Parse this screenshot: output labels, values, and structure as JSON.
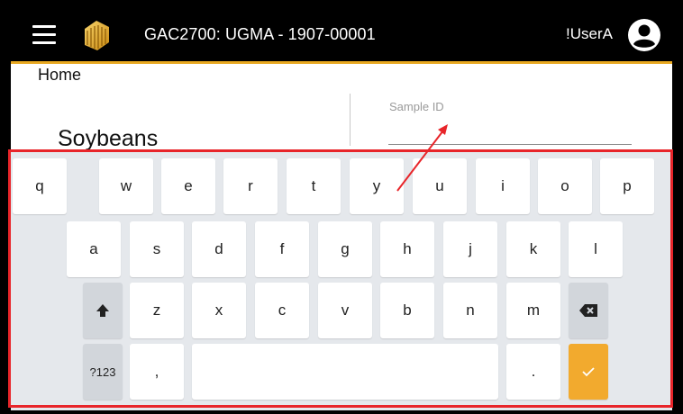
{
  "header": {
    "title": "GAC2700: UGMA - 1907-00001",
    "user": "!UserA",
    "menu_icon": "hamburger-menu-icon",
    "logo_icon": "gac-logo-icon",
    "avatar_icon": "account-circle-icon"
  },
  "breadcrumb": "Home",
  "crop": "Soybeans",
  "sample": {
    "label": "Sample ID",
    "value": ""
  },
  "keyboard": {
    "row1": [
      "q",
      "w",
      "e",
      "r",
      "t",
      "y",
      "u",
      "i",
      "o",
      "p"
    ],
    "row2": [
      "a",
      "s",
      "d",
      "f",
      "g",
      "h",
      "j",
      "k",
      "l"
    ],
    "row3": [
      "z",
      "x",
      "c",
      "v",
      "b",
      "n",
      "m"
    ],
    "shift_icon": "shift-arrow-icon",
    "backspace_icon": "backspace-icon",
    "symbols_label": "?123",
    "comma_label": ",",
    "period_label": ".",
    "enter_icon": "checkmark-icon"
  },
  "colors": {
    "accent": "#f2aa2e",
    "annotation": "#e8252a",
    "topbar": "#000000",
    "keyboard_bg": "#e5e8ec"
  }
}
